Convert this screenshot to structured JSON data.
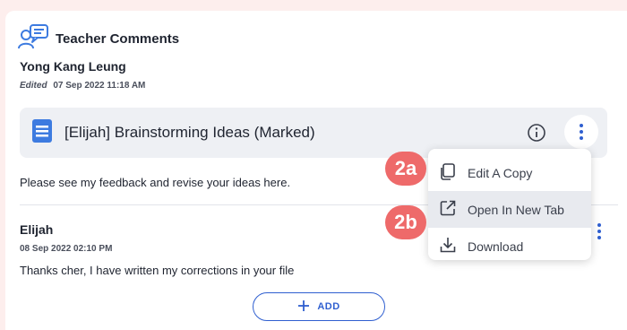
{
  "header": {
    "title": "Teacher Comments",
    "icon": "comments-icon"
  },
  "comment": {
    "author": "Yong Kang Leung",
    "edited_label": "Edited",
    "edited_date": "07 Sep 2022 11:18 AM",
    "attachment_title": "[Elijah] Brainstorming Ideas (Marked)",
    "text": "Please see my feedback and revise your ideas here."
  },
  "reply": {
    "author": "Elijah",
    "date": "08 Sep 2022 02:10 PM",
    "text": "Thanks cher, I have written my corrections in your file"
  },
  "add_button": {
    "label": "ADD"
  },
  "menu": {
    "items": [
      {
        "label": "Edit A Copy",
        "icon": "copy-icon"
      },
      {
        "label": "Open In New Tab",
        "icon": "open-external-icon"
      },
      {
        "label": "Download",
        "icon": "download-icon"
      }
    ]
  },
  "steps": {
    "a": "2a",
    "b": "2b"
  },
  "colors": {
    "accent": "#2f5fd0",
    "doc": "#3d7be0",
    "step": "#ee6a6a",
    "page_bg": "#fdeeed"
  }
}
